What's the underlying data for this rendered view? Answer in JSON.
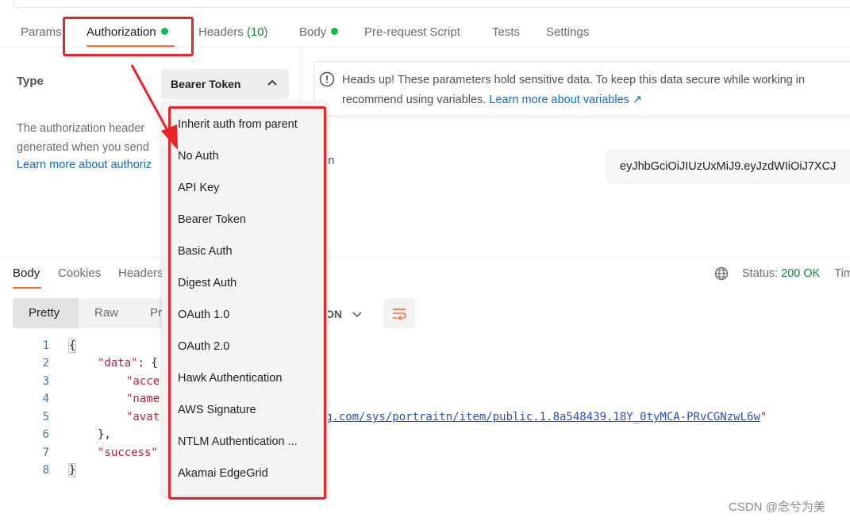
{
  "request_tabs": {
    "params": "Params",
    "authorization": "Authorization",
    "headers": "Headers",
    "headers_count": "(10)",
    "body": "Body",
    "pre_request": "Pre-request Script",
    "tests": "Tests",
    "settings": "Settings"
  },
  "auth": {
    "type_label": "Type",
    "selected_type": "Bearer Token",
    "description_line1": "The authorization header",
    "description_line2": "generated when you send",
    "description_link": "Learn more about authoriz",
    "info_text1": "Heads up! These parameters hold sensitive data. To keep this data secure while working in",
    "info_text2": "recommend using variables.",
    "info_link": "Learn more about variables ↗",
    "token_label": "ken",
    "token_value": "eyJhbGciOiJIUzUxMiJ9.eyJzdWIiOiJ7XCJ"
  },
  "auth_menu": {
    "items": [
      "Inherit auth from parent",
      "No Auth",
      "API Key",
      "Bearer Token",
      "Basic Auth",
      "Digest Auth",
      "OAuth 1.0",
      "OAuth 2.0",
      "Hawk Authentication",
      "AWS Signature",
      "NTLM Authentication ...",
      "Akamai EdgeGrid"
    ]
  },
  "response": {
    "tabs": {
      "body": "Body",
      "cookies": "Cookies",
      "headers": "Headers"
    },
    "status_label": "Status:",
    "status_value": "200 OK",
    "time_label": "Tim",
    "view_modes": {
      "pretty": "Pretty",
      "raw": "Raw",
      "preview": "Pr"
    },
    "format": "ON",
    "code_lines": [
      {
        "n": "1",
        "text": "{"
      },
      {
        "n": "2",
        "key": "\"data\"",
        "rest": ": {"
      },
      {
        "n": "3",
        "key": "\"acce",
        "rest": ""
      },
      {
        "n": "4",
        "key": "\"name",
        "rest": ""
      },
      {
        "n": "5",
        "key": "\"avat",
        "url": "g.com/sys/portraitn/item/public.1.8a548439.18Y_0tyMCA-PRvCGNzwL6w",
        "tail": "\""
      },
      {
        "n": "6",
        "text": "},"
      },
      {
        "n": "7",
        "key": "\"success\"",
        "rest": ""
      },
      {
        "n": "8",
        "text": "}"
      }
    ]
  },
  "watermark": "CSDN @念兮为美",
  "colors": {
    "accent": "#ff6c37",
    "success": "#0cbb52",
    "highlight": "#e8242a",
    "link": "#0b6cd2"
  }
}
